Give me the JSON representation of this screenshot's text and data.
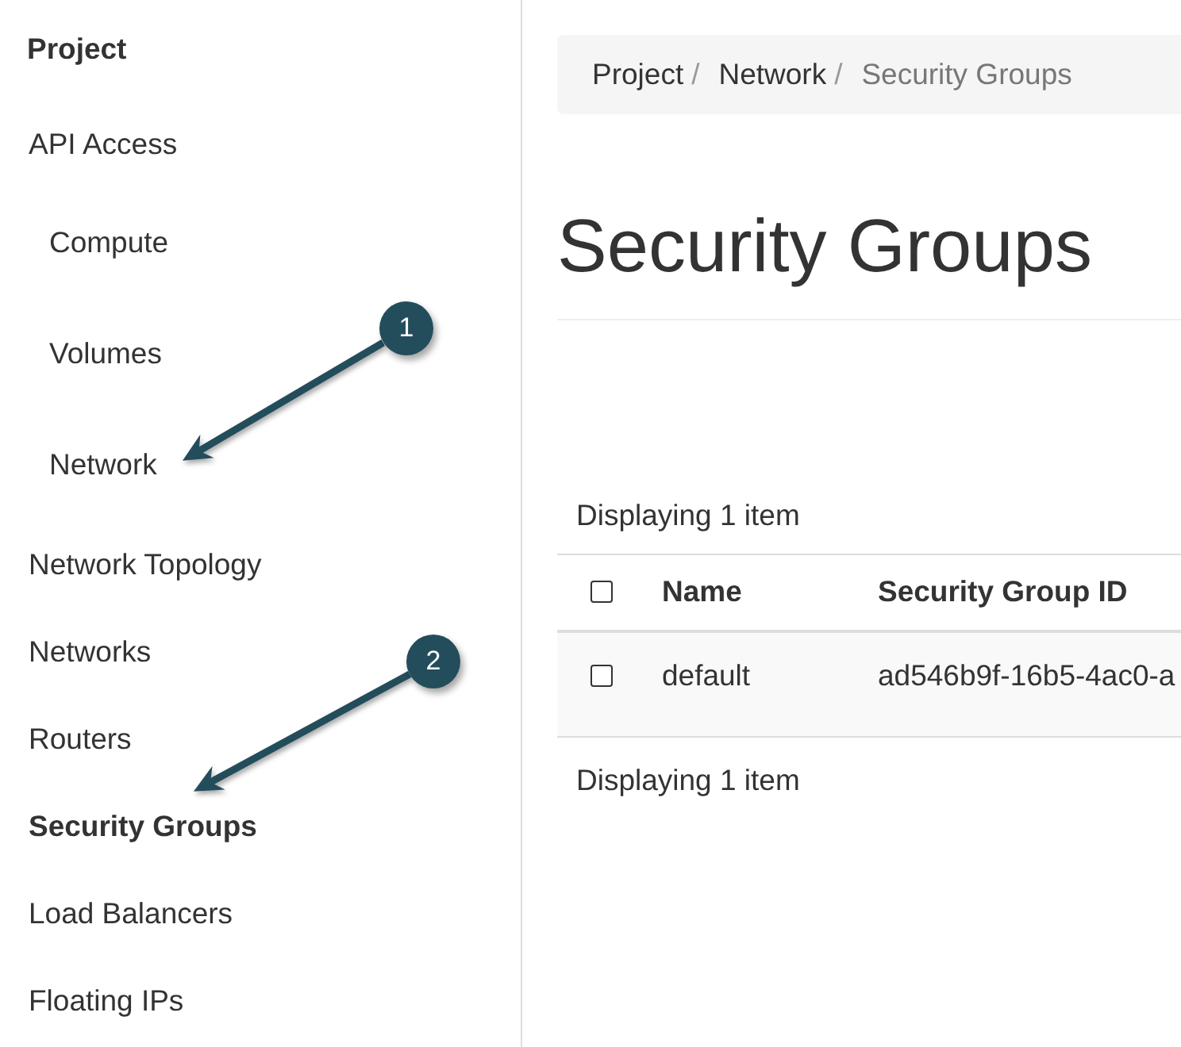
{
  "sidebar": {
    "title": "Project",
    "items": [
      {
        "label": "API Access",
        "kind": "link",
        "selected": false
      },
      {
        "label": "Compute",
        "kind": "group",
        "selected": false
      },
      {
        "label": "Volumes",
        "kind": "group",
        "selected": false
      },
      {
        "label": "Network",
        "kind": "group",
        "selected": false,
        "callout": "1"
      },
      {
        "label": "Network Topology",
        "kind": "link",
        "selected": false
      },
      {
        "label": "Networks",
        "kind": "link",
        "selected": false
      },
      {
        "label": "Routers",
        "kind": "link",
        "selected": false
      },
      {
        "label": "Security Groups",
        "kind": "link",
        "selected": true,
        "callout": "2"
      },
      {
        "label": "Load Balancers",
        "kind": "link",
        "selected": false
      },
      {
        "label": "Floating IPs",
        "kind": "link",
        "selected": false
      }
    ]
  },
  "breadcrumb": [
    {
      "label": "Project",
      "current": false,
      "separator": "/"
    },
    {
      "label": "Network",
      "current": false,
      "separator": "/"
    },
    {
      "label": "Security Groups",
      "current": true
    }
  ],
  "page_title": "Security Groups",
  "table": {
    "count_top": "Displaying 1 item",
    "select_all": {
      "checked": false
    },
    "columns": [
      "Name",
      "Security Group ID"
    ],
    "rows": [
      {
        "checked": false,
        "cells": [
          "default",
          "ad546b9f-16b5-4ac0-a"
        ]
      }
    ],
    "count_bottom": "Displaying 1 item"
  }
}
